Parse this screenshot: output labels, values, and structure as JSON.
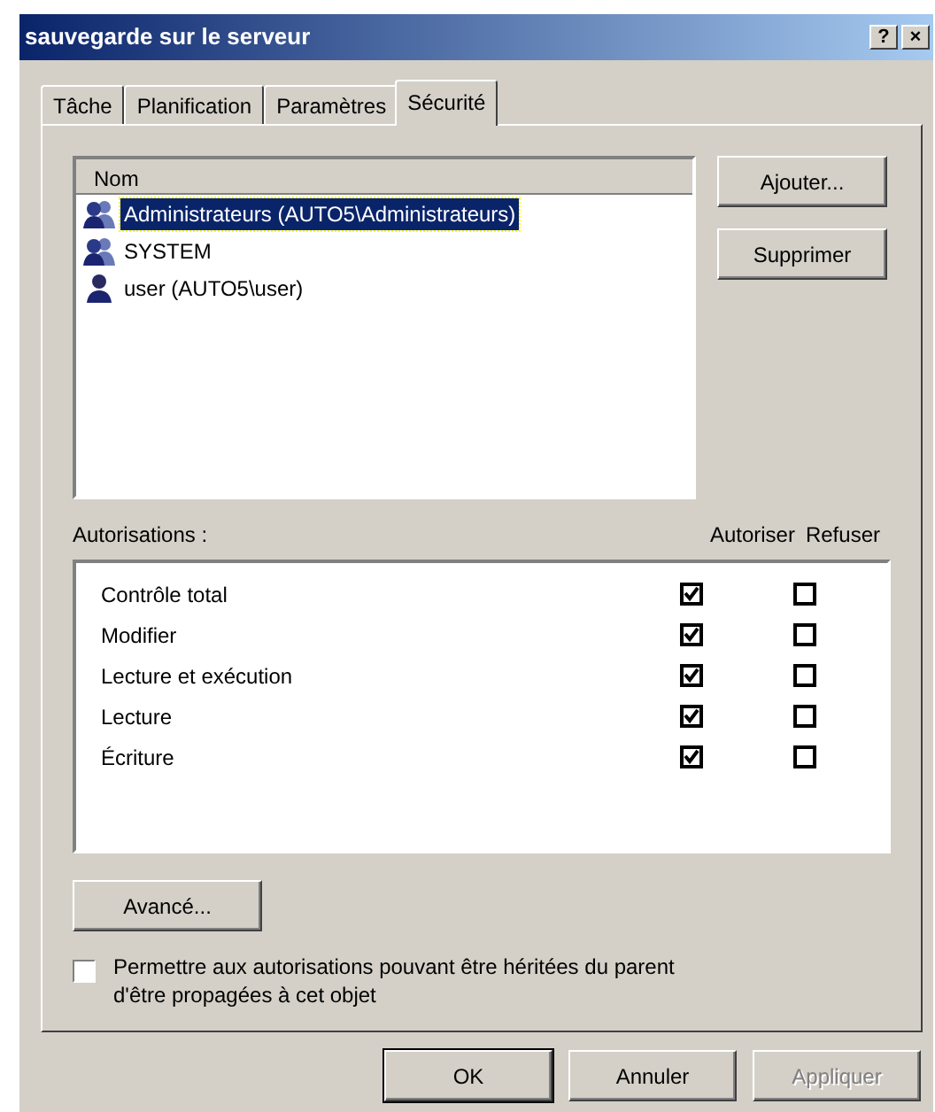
{
  "window": {
    "title": "sauvegarde sur le serveur",
    "help": "?",
    "close": "×"
  },
  "tabs": [
    {
      "label": "Tâche",
      "selected": false
    },
    {
      "label": "Planification",
      "selected": false
    },
    {
      "label": "Paramètres",
      "selected": false
    },
    {
      "label": "Sécurité",
      "selected": true
    }
  ],
  "users": {
    "header": "Nom",
    "items": [
      {
        "kind": "group",
        "label": "Administrateurs (AUTO5\\Administrateurs)",
        "selected": true
      },
      {
        "kind": "group",
        "label": "SYSTEM",
        "selected": false
      },
      {
        "kind": "user",
        "label": "user (AUTO5\\user)",
        "selected": false
      }
    ]
  },
  "user_buttons": [
    "Ajouter...",
    "Supprimer"
  ],
  "permissions": {
    "label": "Autorisations :",
    "allow_header": "Autoriser",
    "deny_header": "Refuser",
    "rows": [
      {
        "name": "Contrôle total",
        "allow": true,
        "deny": false
      },
      {
        "name": "Modifier",
        "allow": true,
        "deny": false
      },
      {
        "name": "Lecture et exécution",
        "allow": true,
        "deny": false
      },
      {
        "name": "Lecture",
        "allow": true,
        "deny": false
      },
      {
        "name": "Écriture",
        "allow": true,
        "deny": false
      }
    ]
  },
  "advanced_button": "Avancé...",
  "inherit": {
    "label": "Permettre aux autorisations pouvant être héritées du parent d'être propagées à cet objet",
    "checked": false
  },
  "footer_buttons": [
    {
      "label": "OK",
      "disabled": false,
      "default": true
    },
    {
      "label": "Annuler",
      "disabled": false,
      "default": false
    },
    {
      "label": "Appliquer",
      "disabled": true,
      "default": false
    }
  ]
}
